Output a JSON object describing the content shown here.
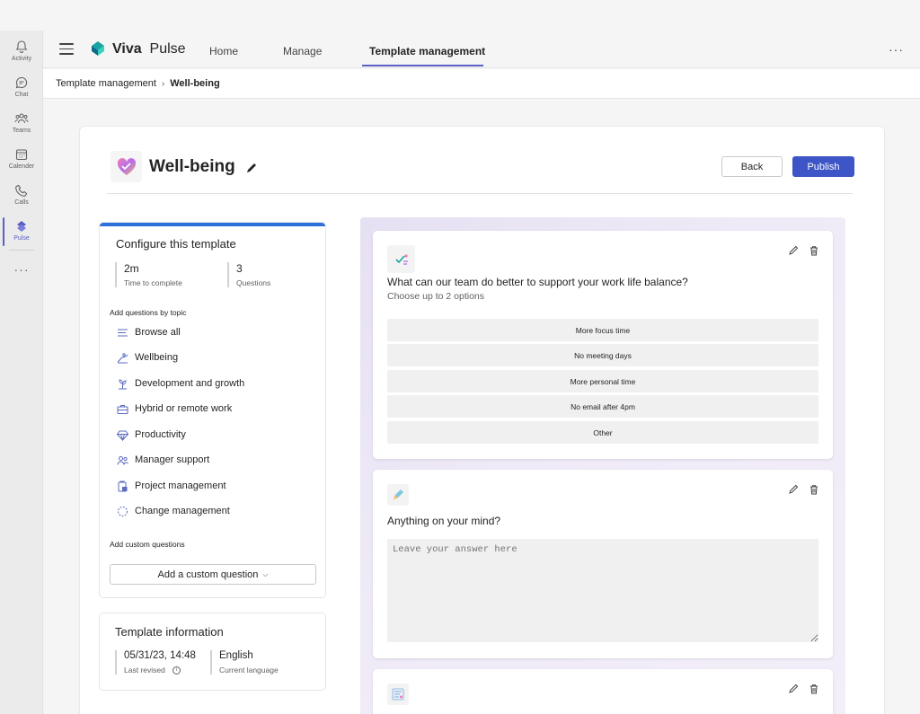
{
  "rail": {
    "items": [
      {
        "label": "Activity",
        "icon": "bell-icon"
      },
      {
        "label": "Chat",
        "icon": "chat-icon"
      },
      {
        "label": "Teams",
        "icon": "teams-icon"
      },
      {
        "label": "Calender",
        "icon": "calendar-icon"
      },
      {
        "label": "Calls",
        "icon": "phone-icon"
      },
      {
        "label": "Pulse",
        "icon": "pulse-icon"
      }
    ],
    "more": "···"
  },
  "header": {
    "brand_prefix": "Viva",
    "brand_suffix": "Pulse",
    "tabs": [
      "Home",
      "Manage",
      "Template management"
    ],
    "active_tab": "Template management",
    "more": "···",
    "accent": "#5b5fc7"
  },
  "breadcrumb": {
    "parent": "Template management",
    "separator": "›",
    "current": "Well-being"
  },
  "template": {
    "title": "Well-being",
    "back_label": "Back",
    "publish_label": "Publish",
    "publish_color": "#3d55c6"
  },
  "configure": {
    "title": "Configure this template",
    "stats": [
      {
        "value": "2m",
        "label": "Time to complete"
      },
      {
        "value": "3",
        "label": "Questions"
      }
    ],
    "topics_heading": "Add questions by topic",
    "topics": [
      {
        "label": "Browse all",
        "icon": "list-icon"
      },
      {
        "label": "Wellbeing",
        "icon": "wellbeing-icon"
      },
      {
        "label": "Development and growth",
        "icon": "growth-icon"
      },
      {
        "label": "Hybrid or remote work",
        "icon": "briefcase-icon"
      },
      {
        "label": "Productivity",
        "icon": "diamond-icon"
      },
      {
        "label": "Manager support",
        "icon": "people-icon"
      },
      {
        "label": "Project management",
        "icon": "clipboard-icon"
      },
      {
        "label": "Change management",
        "icon": "cycle-icon"
      }
    ],
    "custom_heading": "Add custom questions",
    "custom_button": "Add a custom question",
    "custom_chevron": "⌵"
  },
  "info": {
    "title": "Template information",
    "last_revised_value": "05/31/23, 14:48",
    "last_revised_label": "Last revised",
    "language_value": "English",
    "language_label": "Current language"
  },
  "questions": [
    {
      "text": "What can our team do better to support your work life balance?",
      "subtext": "Choose up to 2 options",
      "options": [
        "More focus time",
        "No meeting days",
        "More personal time",
        "No email after 4pm",
        "Other"
      ]
    },
    {
      "text": "Anything on your mind?",
      "placeholder": "Leave your answer here"
    },
    {
      "text": ""
    }
  ]
}
